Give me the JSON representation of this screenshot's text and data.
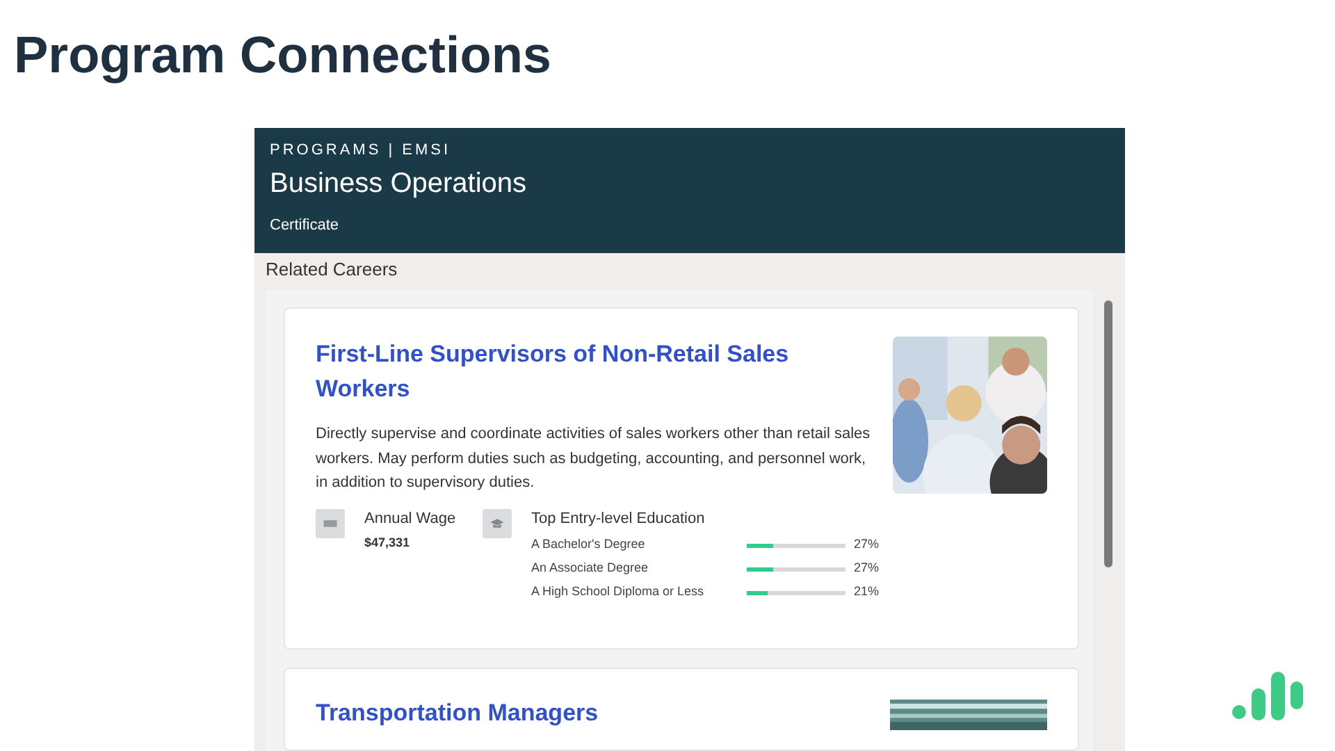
{
  "slide_title": "Program Connections",
  "program": {
    "breadcrumb": "PROGRAMS | EMSI",
    "title": "Business Operations",
    "credential": "Certificate"
  },
  "section_label": "Related Careers",
  "careers": [
    {
      "title": "First-Line Supervisors of Non-Retail Sales Workers",
      "description": "Directly supervise and coordinate activities of sales workers other than retail sales workers. May perform duties such as budgeting, accounting, and personnel work, in addition to supervisory duties.",
      "wage_label": "Annual Wage",
      "wage": "$47,331",
      "education_label": "Top Entry-level Education",
      "education": [
        {
          "name": "A Bachelor's Degree",
          "level": 0.27,
          "percent": "27%"
        },
        {
          "name": "An Associate Degree",
          "level": 0.27,
          "percent": "27%"
        },
        {
          "name": "A High School Diploma or Less",
          "level": 0.21,
          "percent": "21%"
        }
      ]
    },
    {
      "title": "Transportation Managers"
    }
  ]
}
